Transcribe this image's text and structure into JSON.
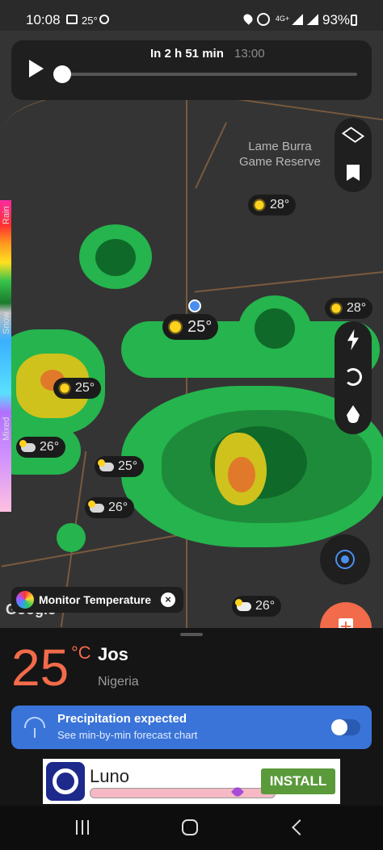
{
  "status_bar": {
    "time": "10:08",
    "temp": "25°",
    "battery": "93%",
    "network": "4G+"
  },
  "player": {
    "label": "In 2 h 51 min",
    "time": "13:00"
  },
  "map": {
    "place_label_line1": "Lame Burra",
    "place_label_line2": "Game Reserve",
    "google": "Google",
    "markers": [
      {
        "temp": "28°",
        "icon": "sun-icon"
      },
      {
        "temp": "28°",
        "icon": "sun-icon"
      },
      {
        "temp": "25°",
        "icon": "sun-icon"
      },
      {
        "temp": "25°",
        "icon": "sun-icon"
      },
      {
        "temp": "26°",
        "icon": "partly-cloudy-icon"
      },
      {
        "temp": "25°",
        "icon": "partly-cloudy-icon"
      },
      {
        "temp": "26°",
        "icon": "partly-cloudy-icon"
      },
      {
        "temp": "26°",
        "icon": "cloud-icon"
      }
    ]
  },
  "legend": {
    "rain": "Rain",
    "snow": "Snow",
    "mixed": "Mixed"
  },
  "monitor": {
    "label": "Monitor Temperature"
  },
  "current": {
    "temperature": "25",
    "unit": "°C",
    "city": "Jos",
    "country": "Nigeria"
  },
  "precipitation": {
    "title": "Precipitation expected",
    "subtitle": "See min-by-min forecast chart"
  },
  "ad": {
    "brand": "Luno",
    "button": "INSTALL"
  },
  "colors": {
    "accent": "#f26b4a",
    "precip_bg": "#3a74d8",
    "install": "#5a9a3a"
  }
}
